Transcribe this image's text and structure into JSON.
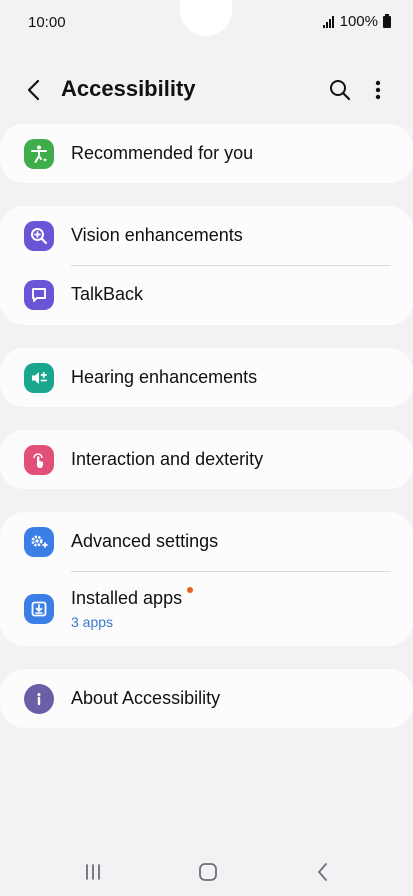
{
  "status": {
    "time": "10:00",
    "battery": "100%"
  },
  "header": {
    "title": "Accessibility"
  },
  "items": {
    "recommended": {
      "label": "Recommended for you",
      "icon": "accessibility-person-icon",
      "color": "#3fae4a"
    },
    "vision": {
      "label": "Vision enhancements",
      "icon": "magnify-plus-icon",
      "color": "#6a55d6"
    },
    "talkback": {
      "label": "TalkBack",
      "icon": "speech-bubble-icon",
      "color": "#6a55d6"
    },
    "hearing": {
      "label": "Hearing enhancements",
      "icon": "speaker-plus-icon",
      "color": "#1aa58f"
    },
    "interaction": {
      "label": "Interaction and dexterity",
      "icon": "touch-hand-icon",
      "color": "#e2507a"
    },
    "advanced": {
      "label": "Advanced settings",
      "icon": "gears-plus-icon",
      "color": "#3b7ee6"
    },
    "installed": {
      "label": "Installed apps",
      "sub": "3 apps",
      "icon": "download-box-icon",
      "color": "#3b7ee6"
    },
    "about": {
      "label": "About Accessibility",
      "icon": "info-icon",
      "color": "#6a5fa6"
    }
  }
}
